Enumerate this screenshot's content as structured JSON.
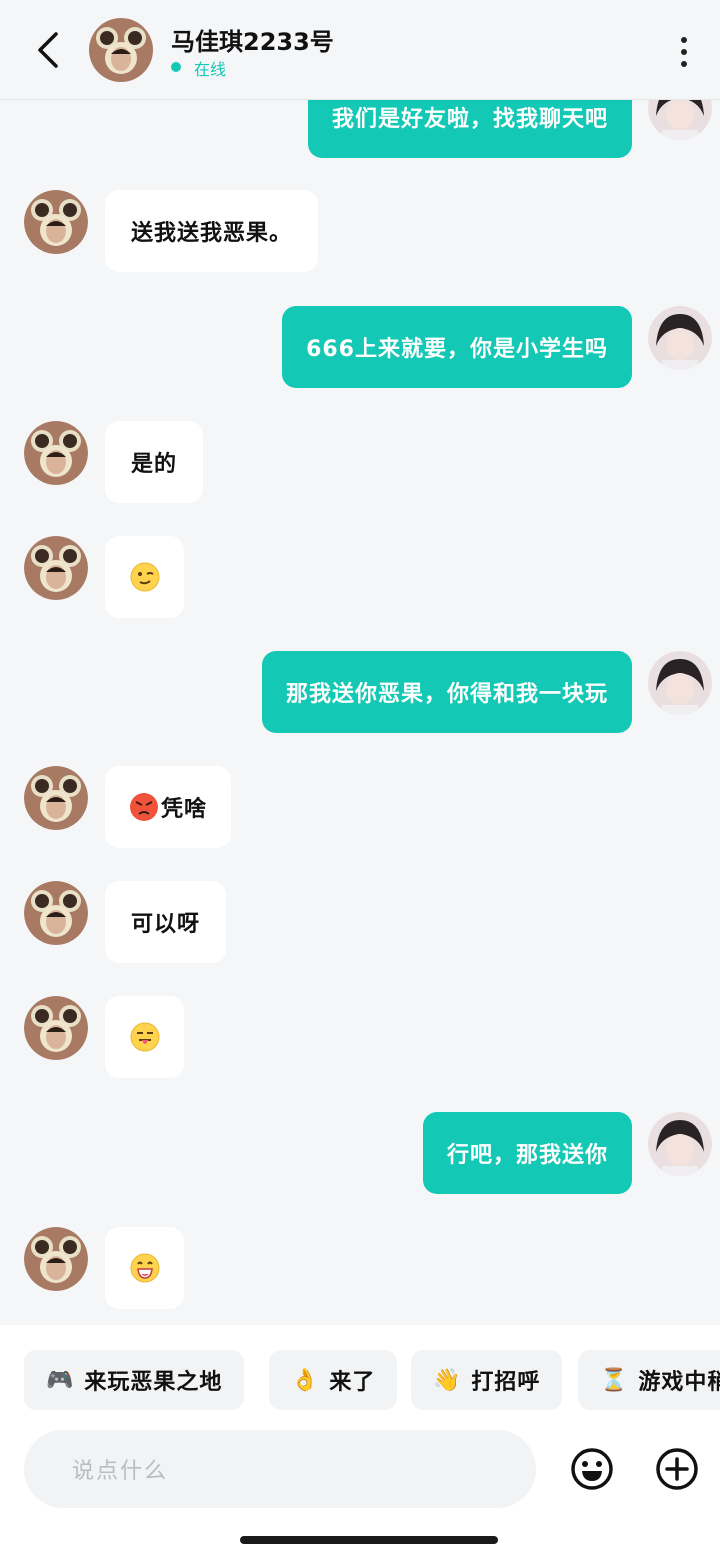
{
  "header": {
    "contact_name": "马佳琪2233号",
    "status": "在线"
  },
  "messages": [
    {
      "side": "right",
      "text": "我们是好友啦，找我聊天吧"
    },
    {
      "side": "left",
      "text": "送我送我恶果。"
    },
    {
      "side": "right",
      "text": "666上来就要，你是小学生吗"
    },
    {
      "side": "left",
      "text": "是的"
    },
    {
      "side": "left",
      "emoji": "wink-face-emoji",
      "text": ""
    },
    {
      "side": "right",
      "text": "那我送你恶果，你得和我一块玩"
    },
    {
      "side": "left",
      "emoji": "angry-face-emoji",
      "text": "凭啥"
    },
    {
      "side": "left",
      "text": "可以呀"
    },
    {
      "side": "left",
      "emoji": "tongue-face-emoji",
      "text": ""
    },
    {
      "side": "right",
      "text": "行吧，那我送你"
    },
    {
      "side": "left",
      "emoji": "grin-face-emoji",
      "text": ""
    }
  ],
  "quick_replies": [
    {
      "icon": "🎮",
      "label": "来玩恶果之地"
    },
    {
      "icon": "👌",
      "label": "来了"
    },
    {
      "icon": "👋",
      "label": "打招呼"
    },
    {
      "icon": "⏳",
      "label": "游戏中稍"
    }
  ],
  "input": {
    "placeholder": "说点什么"
  },
  "colors": {
    "accent": "#13c8b4",
    "background": "#f5f6f8",
    "bubble_left": "#ffffff"
  }
}
